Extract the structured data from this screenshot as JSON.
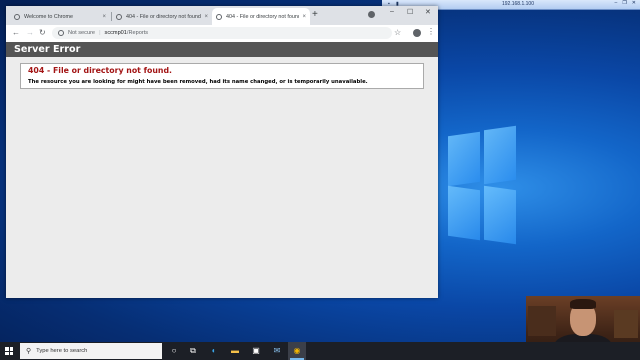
{
  "rdp": {
    "ip": "192.168.1.100"
  },
  "browser": {
    "tabs": [
      {
        "label": "Welcome to Chrome",
        "close": "×"
      },
      {
        "label": "404 - File or directory not found.",
        "close": "×"
      },
      {
        "label": "404 - File or directory not found.",
        "close": "×"
      }
    ],
    "new_tab": "+",
    "window_controls": {
      "minimize": "–",
      "maximize": "☐",
      "close": "✕"
    },
    "toolbar": {
      "back": "←",
      "forward": "→",
      "reload": "↻",
      "security_label": "Not secure",
      "url_host": "sccmp01",
      "url_path": "/Reports",
      "star": "☆",
      "menu": "⋮"
    }
  },
  "page": {
    "header": "Server Error",
    "error_title": "404 - File or directory not found.",
    "error_message": "The resource you are looking for might have been removed, had its name changed, or is temporarily unavailable."
  },
  "taskbar": {
    "search_placeholder": "Type here to search",
    "apps": [
      "task-view",
      "widgets",
      "edge",
      "file-explorer",
      "store",
      "mail",
      "chrome"
    ]
  },
  "colors": {
    "error_header_bg": "#555555",
    "error_title": "#a31515",
    "desktop_accent": "#1366c9",
    "taskbar": "#1c1f26"
  }
}
